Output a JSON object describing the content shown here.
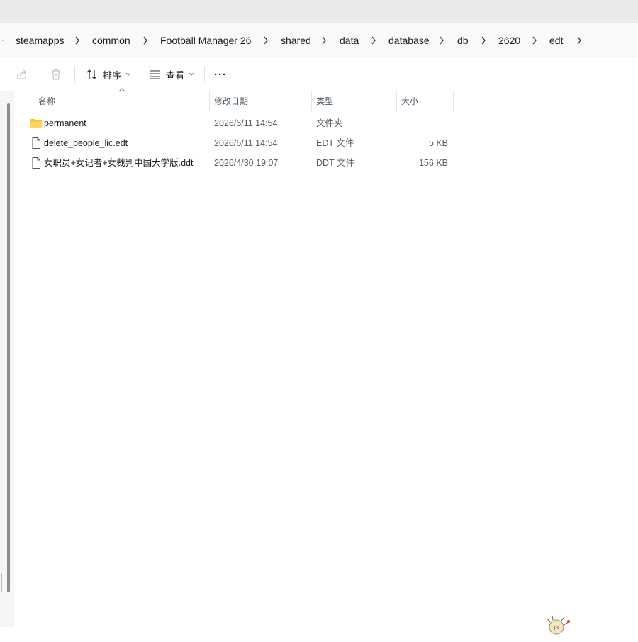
{
  "breadcrumb": {
    "lead": "·",
    "items": [
      {
        "label": "steamapps"
      },
      {
        "label": "common"
      },
      {
        "label": "Football Manager 26"
      },
      {
        "label": "shared"
      },
      {
        "label": "data"
      },
      {
        "label": "database"
      },
      {
        "label": "db"
      },
      {
        "label": "2620"
      },
      {
        "label": "edt"
      }
    ]
  },
  "toolbar": {
    "share_icon": "share-icon",
    "delete_icon": "trash-icon",
    "sort_label": "排序",
    "view_label": "查看",
    "more_label": "···"
  },
  "columns": {
    "name": "名称",
    "modified": "修改日期",
    "type": "类型",
    "size": "大小"
  },
  "files": [
    {
      "name": "permanent",
      "modified": "2026/6/11 14:54",
      "type": "文件夹",
      "size": "",
      "icon": "folder-icon"
    },
    {
      "name": "delete_people_lic.edt",
      "modified": "2026/6/11 14:54",
      "type": "EDT 文件",
      "size": "5 KB",
      "icon": "file-icon"
    },
    {
      "name": "女职员+女记者+女裁判中国大学版.ddt",
      "modified": "2026/4/30 19:07",
      "type": "DDT 文件",
      "size": "156 KB",
      "icon": "file-icon"
    }
  ],
  "colors": {
    "folder": "#f5c342",
    "header_text": "#4a5a6a"
  }
}
